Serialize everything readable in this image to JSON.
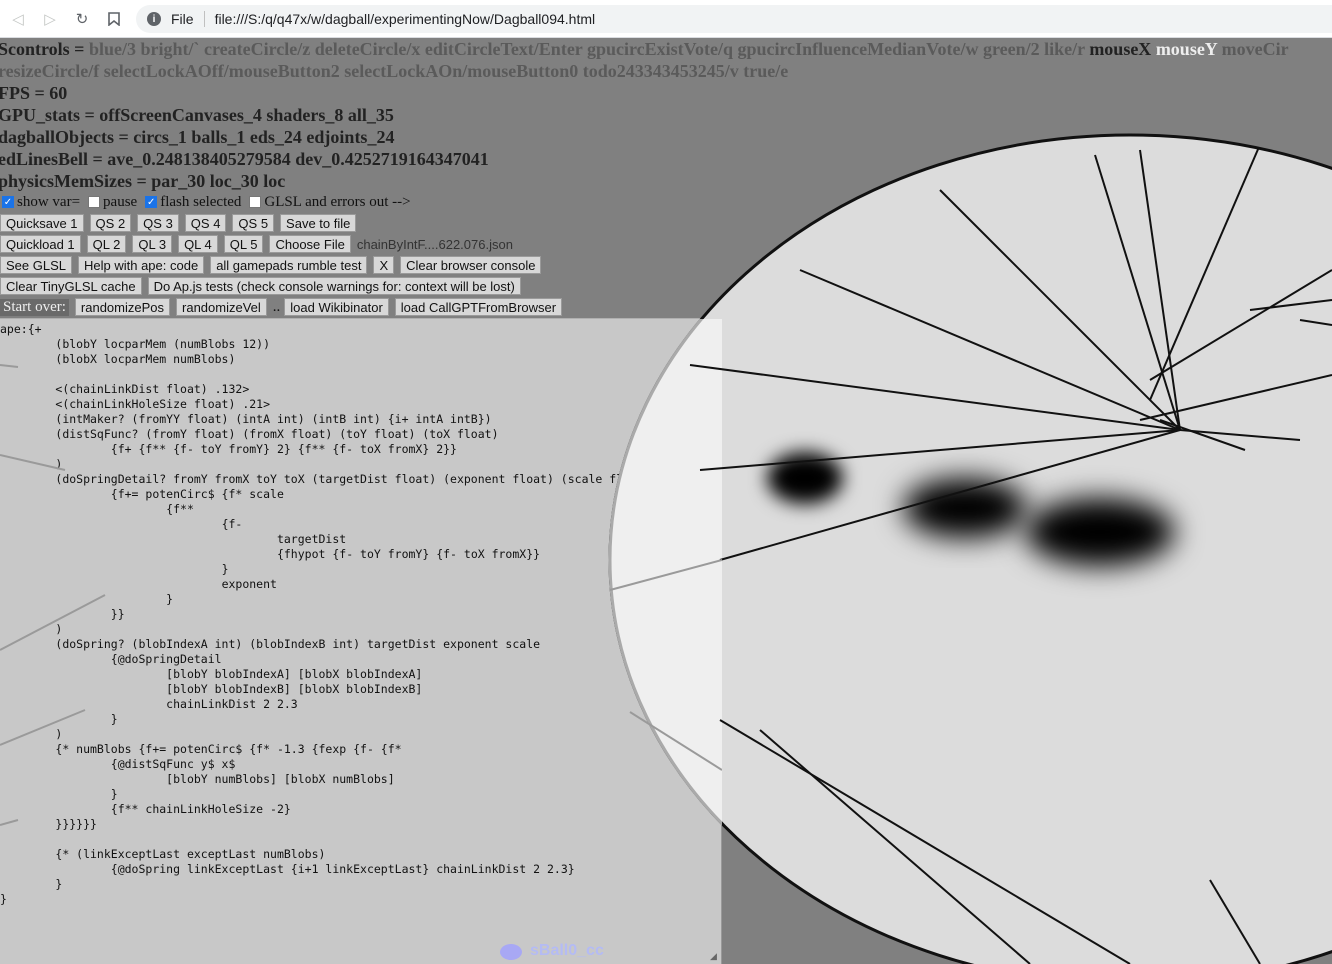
{
  "browser": {
    "back_icon": "arrow-left",
    "forward_icon": "arrow-right",
    "reload_icon": "reload",
    "bookmark_icon": "bookmark",
    "scheme_label": "File",
    "url": "file:///S:/q/q47x/w/dagball/experimentingNow/Dagball094.html"
  },
  "controls_line1": {
    "prefix": "Scontrols = ",
    "items_dim": "blue/3 bright/` createCircle/z deleteCircle/x editCircleText/Enter gpucircExistVote/q gpucircInfluenceMedianVote/w green/2 like/r",
    "mouseX": "mouseX",
    "mouseY": "mouseY",
    "tail": "moveCir"
  },
  "controls_line2": "resizeCircle/f selectLockAOff/mouseButton2 selectLockAOn/mouseButton0 todo243343453245/v true/e",
  "stats": {
    "fps": "FPS = 60",
    "gpu": "GPU_stats = offScreenCanvases_4 shaders_8 all_35",
    "objects": "dagballObjects = circs_1 balls_1 eds_24 edjoints_24",
    "bell": "edLinesBell = ave_0.248138405279584 dev_0.4252719164347041",
    "mem": "physicsMemSizes = par_30 loc_30 loc"
  },
  "options": {
    "show_var": "show var=",
    "pause": "pause",
    "flash_selected": "flash selected",
    "glsl_errors": "GLSL and errors out -->"
  },
  "buttons": {
    "quicksave1": "Quicksave 1",
    "qs2": "QS 2",
    "qs3": "QS 3",
    "qs4": "QS 4",
    "qs5": "QS 5",
    "save_to_file": "Save to file",
    "quickload1": "Quickload 1",
    "ql2": "QL 2",
    "ql3": "QL 3",
    "ql4": "QL 4",
    "ql5": "QL 5",
    "choose_file": "Choose File",
    "chosen_filename": "chainByIntF....622.076.json",
    "see_glsl": "See GLSL",
    "help_ape": "Help with ape: code",
    "gamepads": "all gamepads rumble test",
    "x": "X",
    "clear_console": "Clear browser console",
    "clear_tinyglsl": "Clear TinyGLSL cache",
    "do_ap_tests": "Do Ap.js tests (check console warnings for: context will be lost)",
    "start_over": "Start over:",
    "randomize_pos": "randomizePos",
    "randomize_vel": "randomizeVel",
    "dots": "..",
    "load_wikibinator": "load Wikibinator",
    "load_callgpt": "load CallGPTFromBrowser"
  },
  "code": "ape:{+\n\t(blobY locparMem (numBlobs 12))\n\t(blobX locparMem numBlobs)\n\n\t<(chainLinkDist float) .132>\n\t<(chainLinkHoleSize float) .21>\n\t(intMaker? (fromYY float) (intA int) (intB int) {i+ intA intB})\n\t(distSqFunc? (fromY float) (fromX float) (toY float) (toX float)\n\t\t{f+ {f** {f- toY fromY} 2} {f** {f- toX fromX} 2}}\n\t)\n\t(doSpringDetail? fromY fromX toY toX (targetDist float) (exponent float) (scale float)\n\t\t{f+= potenCirc$ {f* scale\n\t\t\t{f**\n\t\t\t\t{f-\n\t\t\t\t\ttargetDist\n\t\t\t\t\t{fhypot {f- toY fromY} {f- toX fromX}}\n\t\t\t\t}\n\t\t\t\texponent\n\t\t\t}\n\t\t}}\n\t)\n\t(doSpring? (blobIndexA int) (blobIndexB int) targetDist exponent scale\n\t\t{@doSpringDetail\n\t\t\t[blobY blobIndexA] [blobX blobIndexA]\n\t\t\t[blobY blobIndexB] [blobX blobIndexB]\n\t\t\tchainLinkDist 2 2.3\n\t\t}\n\t)\n\t{* numBlobs {f+= potenCirc$ {f* -1.3 {fexp {f- {f*\n\t\t{@distSqFunc y$ x$\n\t\t\t[blobY numBlobs] [blobX numBlobs]\n\t\t}\n\t\t{f** chainLinkHoleSize -2}\n\t}}}}}}\n\n\t{* (linkExceptLast exceptLast numBlobs)\n\t\t{@doSpring linkExceptLast {i+1 linkExceptLast} chainLinkDist 2 2.3}\n\t}\n}",
  "ball_label": "sBall0_cc",
  "colors": {
    "background": "#808080",
    "circle_fill": "#d8d8d8",
    "circle_edge": "#111111",
    "panel": "#c8c8c8",
    "checkbox_on": "#1a73e8"
  }
}
